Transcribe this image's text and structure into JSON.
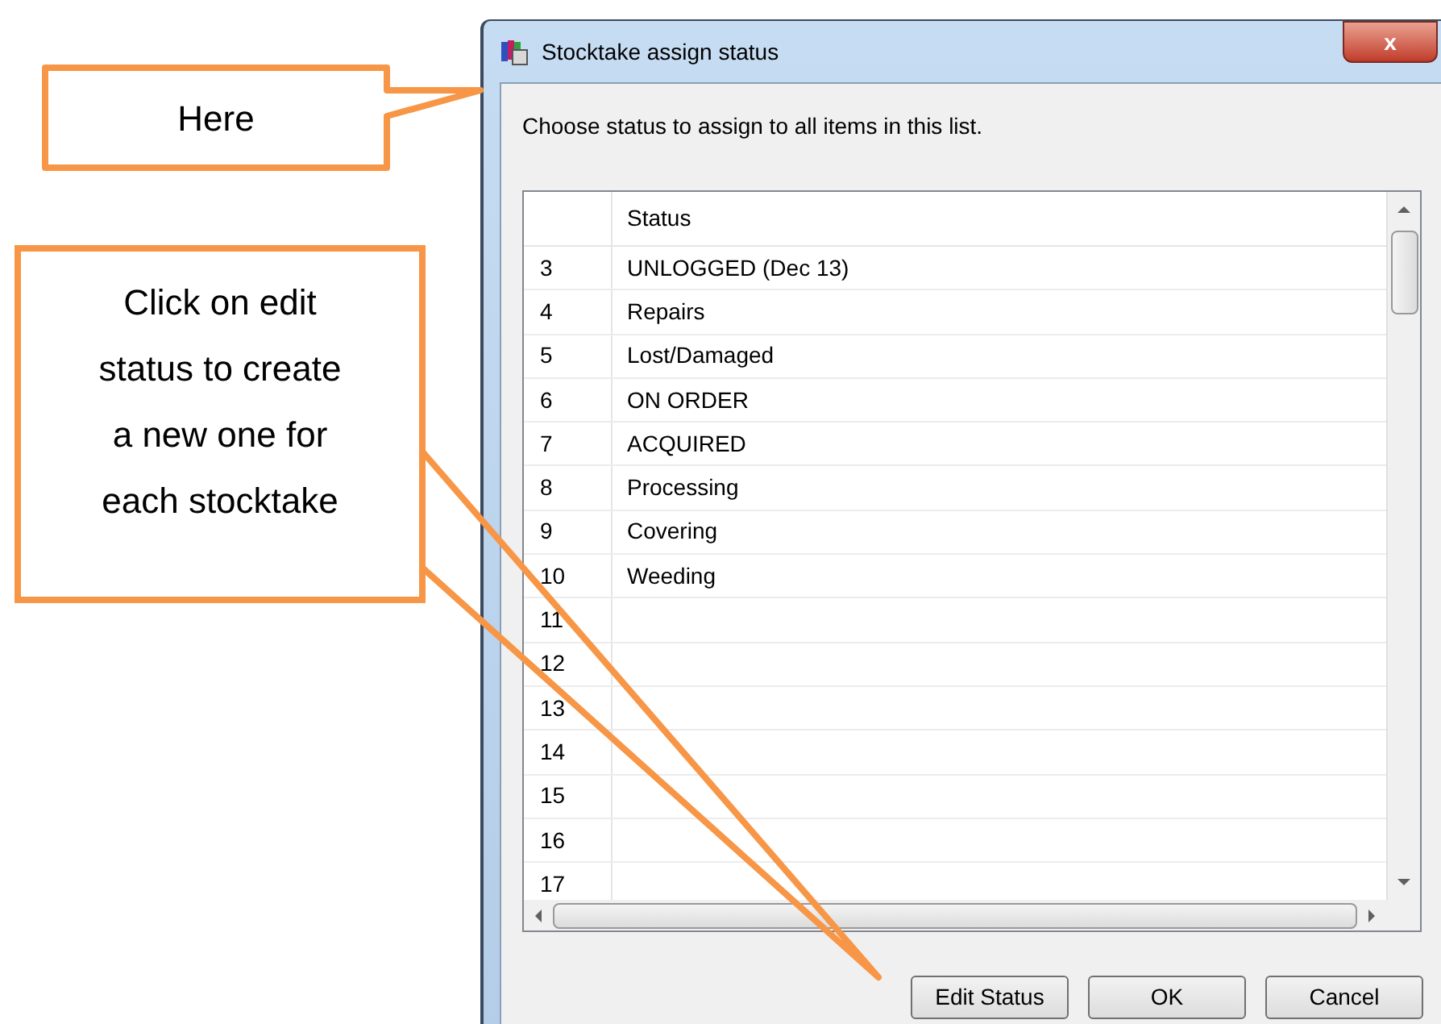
{
  "window": {
    "title": "Stocktake assign status",
    "close": "x"
  },
  "prompt": "Choose status to assign to all items in this list.",
  "table": {
    "columns": [
      "Status"
    ],
    "rows": [
      {
        "number": "3",
        "status": "UNLOGGED (Dec 13)"
      },
      {
        "number": "4",
        "status": "Repairs"
      },
      {
        "number": "5",
        "status": "Lost/Damaged"
      },
      {
        "number": "6",
        "status": "ON ORDER"
      },
      {
        "number": "7",
        "status": "ACQUIRED"
      },
      {
        "number": "8",
        "status": "Processing"
      },
      {
        "number": "9",
        "status": "Covering"
      },
      {
        "number": "10",
        "status": "Weeding"
      },
      {
        "number": "11"
      },
      {
        "number": "12"
      },
      {
        "number": "13"
      },
      {
        "number": "14"
      },
      {
        "number": "15"
      },
      {
        "number": "16"
      },
      {
        "number": "17"
      }
    ]
  },
  "buttons": [
    "Edit Status",
    "OK",
    "Cancel"
  ],
  "callouts": [
    {
      "text": "Here"
    },
    {
      "text": "Click on edit status to create a new one for each stocktake"
    }
  ]
}
